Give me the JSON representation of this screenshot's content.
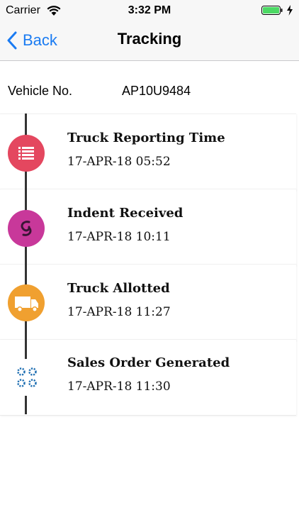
{
  "status_bar": {
    "carrier": "Carrier",
    "time": "3:32 PM"
  },
  "nav": {
    "back_label": "Back",
    "title": "Tracking"
  },
  "vehicle": {
    "label": "Vehicle No.",
    "value": "AP10U9484"
  },
  "steps": [
    {
      "title": "Truck Reporting Time",
      "time": "17-APR-18 05:52",
      "icon": "list-icon",
      "color": "#e4475f"
    },
    {
      "title": "Indent Received",
      "time": "17-APR-18 10:11",
      "icon": "swirl-icon",
      "color": "#c8389a"
    },
    {
      "title": "Truck Allotted",
      "time": "17-APR-18 11:27",
      "icon": "truck-icon",
      "color": "#f0a030"
    },
    {
      "title": "Sales Order Generated",
      "time": "17-APR-18 11:30",
      "icon": "gears-icon",
      "color": "#1f6fb2"
    }
  ]
}
